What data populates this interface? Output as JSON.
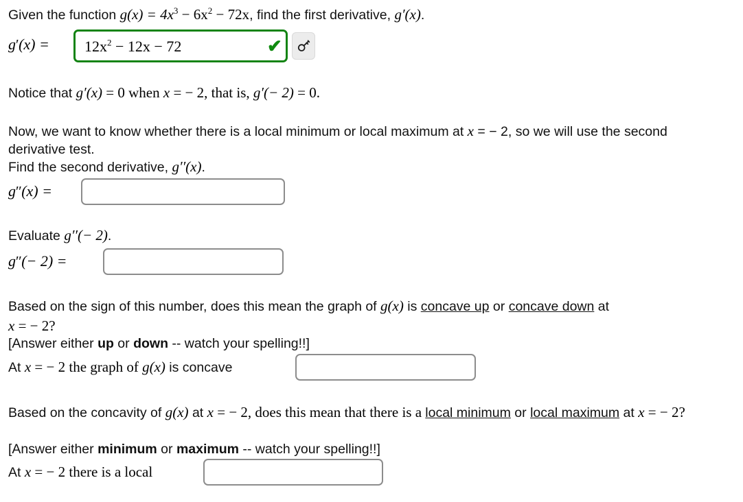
{
  "problem": {
    "intro_prefix": "Given the function ",
    "function_label": "g(x) = 4x",
    "function_exp1": "3",
    "function_mid": " − 6x",
    "function_exp2": "2",
    "function_tail": " − 72x",
    "intro_suffix": ", find the first derivative, ",
    "first_derivative_name": "g′(x)",
    "intro_period": "."
  },
  "q1": {
    "prompt_label_g": "g",
    "prompt_label_prime": "′",
    "prompt_label_arg": "(x) =",
    "answer_value": "12x",
    "answer_exp": "2",
    "answer_rest": " − 12x − 72",
    "status": "correct",
    "check_glyph": "✔",
    "key_button_title": "Show answer key",
    "border_color": "#128312"
  },
  "notice": {
    "text_1": "Notice that ",
    "math_1": "g′(x)",
    "text_2": " = 0 when ",
    "math_2": "x",
    "text_3": " = − 2, that is, ",
    "math_3": "g′(− 2)",
    "text_4": " = 0."
  },
  "explain": {
    "line1_a": "Now, we want to know whether there is a local minimum or local maximum at ",
    "line1_math": "x",
    "line1_b": " = − 2, so we will use the second derivative test.",
    "line2_a": "Find the second derivative, ",
    "line2_math": "g′′(x)",
    "line2_b": "."
  },
  "q2": {
    "label_g": "g",
    "label_primes": "′′",
    "label_arg": "(x) =",
    "value": "",
    "placeholder": ""
  },
  "evaluate": {
    "text_a": "Evaluate ",
    "math": "g′′(− 2)",
    "text_b": "."
  },
  "q3": {
    "label_g": "g",
    "label_primes": "′′",
    "label_arg": "(− 2) =",
    "value": "",
    "placeholder": ""
  },
  "concavity": {
    "line1_a": "Based on the sign of this number, does this mean the graph of ",
    "line1_math": "g(x)",
    "line1_b": " is ",
    "link_up": "concave up",
    "line1_or": " or ",
    "link_down": "concave down",
    "line1_c": " at ",
    "line2_math": "x",
    "line2_b": " = − 2?",
    "hint_a": "[Answer either ",
    "hint_bold_1": "up",
    "hint_mid": " or ",
    "hint_bold_2": "down",
    "hint_b": " -- watch your spelling!!]"
  },
  "q4": {
    "label_a": "At ",
    "label_math": "x",
    "label_b": " = − 2 the graph of ",
    "label_math2": "g(x)",
    "label_c": " is concave",
    "value": "",
    "placeholder": ""
  },
  "extremum": {
    "line1_a": "Based on the concavity of ",
    "line1_math": "g(x)",
    "line1_b": " at ",
    "line1_math2": "x",
    "line1_c": " = − 2, does this mean that there is a ",
    "link_min": "local minimum",
    "line1_or": " or ",
    "link_max": "local maximum",
    "line2_a": " at ",
    "line2_math": "x",
    "line2_b": " = − 2?",
    "hint_a": "[Answer either ",
    "hint_bold_1": "minimum",
    "hint_mid": " or ",
    "hint_bold_2": "maximum",
    "hint_b": " -- watch your spelling!!]"
  },
  "q5": {
    "label_a": "At ",
    "label_math": "x",
    "label_b": " = − 2 there is a local",
    "value": "",
    "placeholder": ""
  },
  "colors": {
    "correct_green": "#128312",
    "input_border": "#8c8c8c",
    "text": "#111111",
    "key_button_bg": "#ececec"
  }
}
